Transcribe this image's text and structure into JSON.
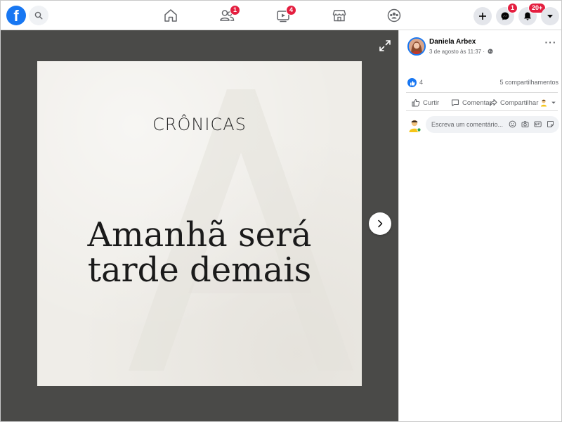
{
  "header": {
    "logo_text": "f",
    "badges": {
      "friends": "1",
      "watch": "4",
      "messenger": "1",
      "notifications": "20+"
    },
    "brand_color": "#1877f2",
    "badge_color": "#e41e3f"
  },
  "photo": {
    "kicker": "CRÔNICAS",
    "title_line1": "Amanhã será",
    "title_line2": "tarde demais"
  },
  "post": {
    "author": "Daniela Arbex",
    "time": "3 de agosto às 11:37 ·",
    "like_count": "4",
    "shares": "5 compartilhamentos"
  },
  "actions": {
    "like": "Curtir",
    "comment": "Comentar",
    "share": "Compartilhar"
  },
  "comment": {
    "placeholder": "Escreva um comentário..."
  },
  "icons": {
    "logo": "facebook-logo",
    "search": "search-icon",
    "home": "home-icon",
    "friends": "friends-icon",
    "watch": "watch-icon",
    "marketplace": "marketplace-icon",
    "groups": "groups-icon",
    "create": "plus-icon",
    "messenger": "messenger-icon",
    "notifications": "bell-icon",
    "account": "caret-down-icon"
  }
}
